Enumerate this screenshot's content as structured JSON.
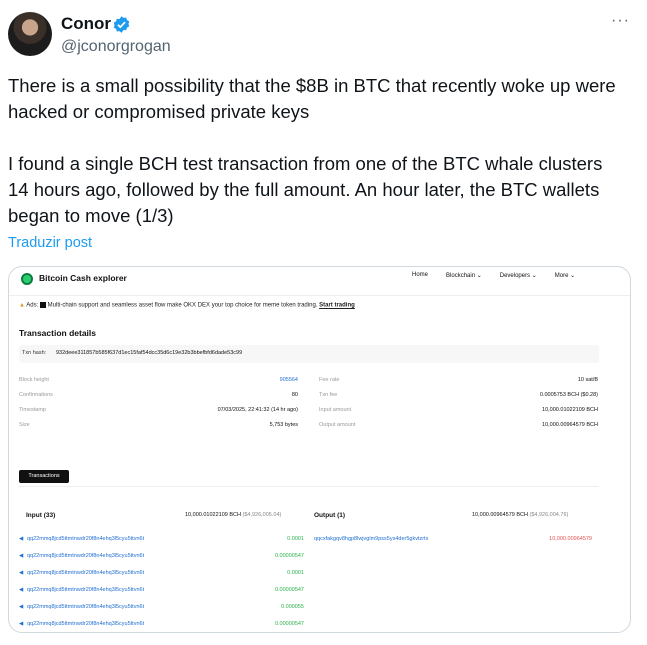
{
  "tweet": {
    "author_name": "Conor",
    "handle": "@jconorgrogan",
    "more_icon": "···",
    "paragraph1": "There is a small possibility that the $8B in BTC that recently woke up were hacked or compromised private keys",
    "paragraph2": "I found a single BCH test transaction from one of the BTC whale clusters 14 hours ago, followed by the full amount. An hour later, the BTC wallets began to move (1/3)",
    "translate_link": "Traduzir post",
    "verified_color": "#1d9bf0"
  },
  "explorer": {
    "brand": "Bitcoin Cash explorer",
    "nav": [
      "Home",
      "Blockchain ⌄",
      "Developers ⌄",
      "More ⌄"
    ],
    "ads_prefix": "Ads:",
    "ads_text": "Multi-chain support and seamless asset flow make OKX DEX your top choice for meme token trading.",
    "ads_link": "Start trading",
    "section_title": "Transaction details",
    "txn_hash_label": "Txn hash:",
    "txn_hash": "932deee311857b585f637d1ec15faf54dcc35d6c19e32b3bbefbfd6dade53c99",
    "left_details": [
      {
        "label": "Block height",
        "value": "905564",
        "link": true
      },
      {
        "label": "Confirmations",
        "value": "80",
        "link": false
      },
      {
        "label": "Timestamp",
        "value": "07/03/2025, 22:41:32 (14 hr ago)",
        "link": false
      },
      {
        "label": "Size",
        "value": "5,753 bytes",
        "link": false
      }
    ],
    "right_details": [
      {
        "label": "Fee rate",
        "value": "10 sat/B"
      },
      {
        "label": "Txn fee",
        "value": "0.0005753 BCH ($0.28)"
      },
      {
        "label": "Input amount",
        "value": "10,000.01022109 BCH"
      },
      {
        "label": "Output amount",
        "value": "10,000.00964579 BCH"
      }
    ],
    "transactions_button": "Transactions",
    "input": {
      "title": "Input (33)",
      "total": "10,000.01022109 BCH",
      "total_usd": "($4,926,005.04)",
      "rows": [
        {
          "addr": "qq22mmq8jcd5ttmtnwdr20f8n4ehq3l5cyu5ttvn6t",
          "amount": "0.0001"
        },
        {
          "addr": "qq22mmq8jcd5ttmtnwdr20f8n4ehq3l5cyu5ttvn6t",
          "amount": "0.00000547"
        },
        {
          "addr": "qq22mmq8jcd5ttmtnwdr20f8n4ehq3l5cyu5ttvn6t",
          "amount": "0.0001"
        },
        {
          "addr": "qq22mmq8jcd5ttmtnwdr20f8n4ehq3l5cyu5ttvn6t",
          "amount": "0.00000547"
        },
        {
          "addr": "qq22mmq8jcd5ttmtnwdr20f8n4ehq3l5cyu5ttvn6t",
          "amount": "0.000055"
        },
        {
          "addr": "qq22mmq8jcd5ttmtnwdr20f8n4ehq3l5cyu5ttvn6t",
          "amount": "0.00000547"
        }
      ]
    },
    "output": {
      "title": "Output (1)",
      "total": "10,000.00964579 BCH",
      "total_usd": "($4,926,004.76)",
      "rows": [
        {
          "addr": "qqcxfakgqv8hgp8lwjvglm9pss5ys4der5gkvtzrtx",
          "amount": "10,000.00964579"
        }
      ]
    }
  }
}
